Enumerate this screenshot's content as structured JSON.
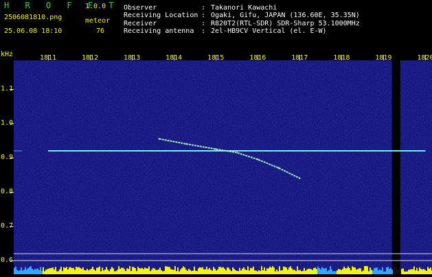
{
  "app": {
    "title": "H R O F F T",
    "version": "1.0.0",
    "filename": "2506081810.png",
    "datetime": "25.06.08 18:10",
    "mode_label": "meteor",
    "count": "76"
  },
  "info": {
    "rows": [
      {
        "key": "Observer",
        "sep": ":",
        "value": "Takanori Kawachi"
      },
      {
        "key": "Receiving Location",
        "sep": ":",
        "value": "Ogaki, Gifu, JAPAN (136.60E, 35.35N)"
      },
      {
        "key": "Receiver",
        "sep": ":",
        "value": "R820T2(RTL-SDR) SDR-Sharp 53.1000MHz"
      },
      {
        "key": "Receiving antenna",
        "sep": ":",
        "value": "2el-HB9CV Vertical (el. E-W)"
      }
    ]
  },
  "axes": {
    "y_unit": "kHz",
    "x_ticks": [
      "1811",
      "1812",
      "1813",
      "1814",
      "1815",
      "1816",
      "1817",
      "1818",
      "1819",
      "1820"
    ],
    "y_ticks": [
      "1.1",
      "1.0",
      "0.9",
      "0.8",
      "0.7",
      "0.6"
    ]
  },
  "colors": {
    "background": "#000000",
    "spectrum_bg": "#0b0b6a",
    "carrier": "#7fe8ff",
    "meteor_trail": "#a8ffb0",
    "baseline_fill": "#f5f500",
    "baseline_alt": "#2fa8ff",
    "text_green": "#2fdc2f",
    "text_yellow": "#f5f500"
  },
  "spectrogram": {
    "carrier_freq_khz": 0.92,
    "carrier_start_min": 1811.0,
    "carrier_end_min": 1820.0,
    "meteor_trail": [
      {
        "t": 1813.65,
        "f": 0.955
      },
      {
        "t": 1814.3,
        "f": 0.94
      },
      {
        "t": 1815.0,
        "f": 0.925
      },
      {
        "t": 1815.5,
        "f": 0.915
      },
      {
        "t": 1816.0,
        "f": 0.895
      },
      {
        "t": 1816.5,
        "f": 0.87
      },
      {
        "t": 1817.0,
        "f": 0.84
      }
    ],
    "dropout_min": [
      1819.2,
      1819.4
    ]
  }
}
